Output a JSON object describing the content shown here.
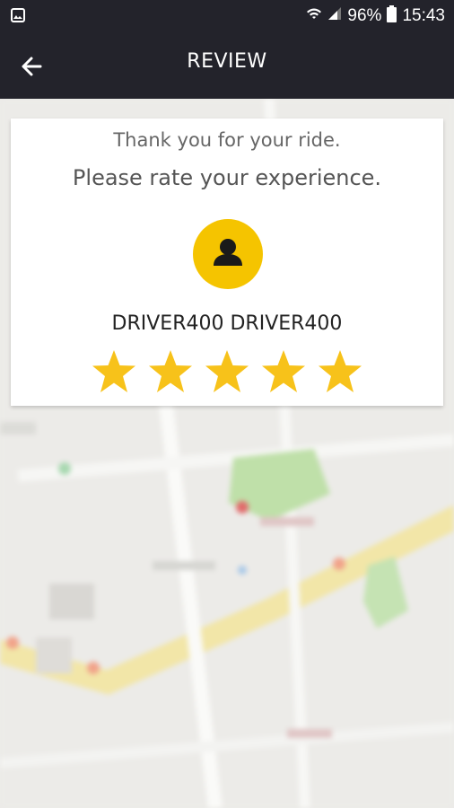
{
  "status_bar": {
    "battery": "96%",
    "time": "15:43",
    "icons": [
      "image-icon",
      "wifi-icon",
      "signal-icon",
      "battery-icon"
    ]
  },
  "app_bar": {
    "title": "REVIEW",
    "back_icon": "arrow-left-icon"
  },
  "review_card": {
    "thank_you_text": "Thank you for your ride.",
    "prompt_text": "Please rate your experience.",
    "avatar_icon": "person-icon",
    "driver_name": "DRIVER400 DRIVER400",
    "rating": {
      "value": 5,
      "max": 5
    }
  },
  "colors": {
    "header": "#23232b",
    "accent_yellow": "#f5c400",
    "star_yellow": "#f7c21a",
    "text_gray": "#666666"
  }
}
